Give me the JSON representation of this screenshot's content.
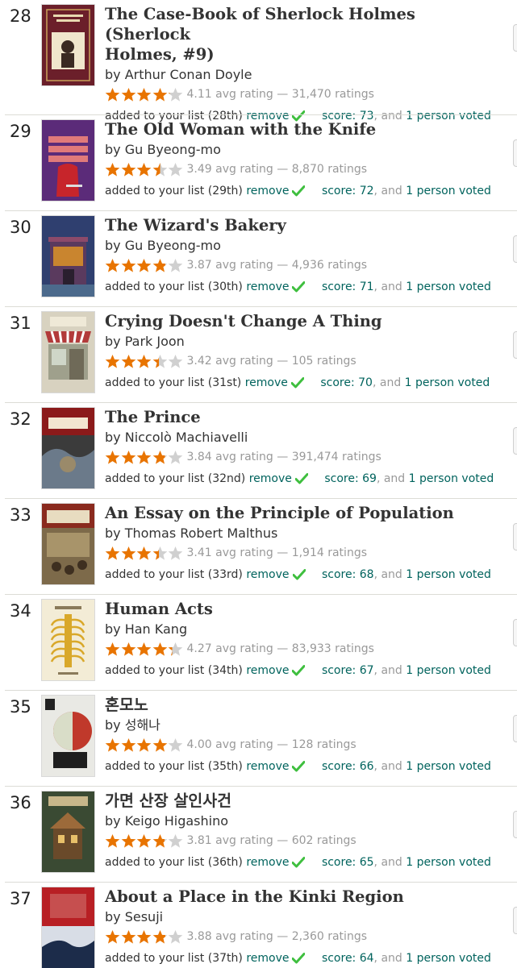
{
  "colors": {
    "link": "#00635d",
    "star": "#e87400",
    "star_empty": "#d0d0d0",
    "check": "#3fbf3f",
    "muted": "#999999",
    "text": "#333333"
  },
  "books": [
    {
      "rank": "28",
      "title_lines": [
        "The Case-Book of Sherlock Holmes (Sherlock",
        "Holmes, #9)"
      ],
      "by": "by",
      "author": "Arthur Conan Doyle",
      "rating": 4.11,
      "rating_text": "4.11 avg rating — 31,470 ratings",
      "added_prefix": "added to your list (28th)",
      "remove_label": "remove",
      "score_label": "score: 73",
      "score_sep": ", and",
      "voted_label": "1 person voted",
      "cover": {
        "bg": "#6b1f2a",
        "accent": "#f0e6cc",
        "icon": "sherlock-cover"
      }
    },
    {
      "rank": "29",
      "title_lines": [
        "The Old Woman with the Knife"
      ],
      "by": "by",
      "author": "Gu Byeong-mo",
      "rating": 3.49,
      "rating_text": "3.49 avg rating — 8,870 ratings",
      "added_prefix": "added to your list (29th)",
      "remove_label": "remove",
      "score_label": "score: 72",
      "score_sep": ", and",
      "voted_label": "1 person voted",
      "cover": {
        "bg": "#5b2b79",
        "accent": "#c7252b",
        "icon": "old-woman-cover"
      }
    },
    {
      "rank": "30",
      "title_lines": [
        "The Wizard's Bakery"
      ],
      "by": "by",
      "author": "Gu Byeong-mo",
      "rating": 3.87,
      "rating_text": "3.87 avg rating — 4,936 ratings",
      "added_prefix": "added to your list (30th)",
      "remove_label": "remove",
      "score_label": "score: 71",
      "score_sep": ", and",
      "voted_label": "1 person voted",
      "cover": {
        "bg": "#2f3f6f",
        "accent": "#c9852f",
        "icon": "bakery-cover"
      }
    },
    {
      "rank": "31",
      "title_lines": [
        "Crying Doesn't Change A Thing"
      ],
      "by": "by",
      "author": "Park Joon",
      "rating": 3.42,
      "rating_text": "3.42 avg rating — 105 ratings",
      "added_prefix": "added to your list (31st)",
      "remove_label": "remove",
      "score_label": "score: 70",
      "score_sep": ", and",
      "voted_label": "1 person voted",
      "cover": {
        "bg": "#d8d2c0",
        "accent": "#b23a3a",
        "icon": "storefront-cover"
      }
    },
    {
      "rank": "32",
      "title_lines": [
        "The Prince"
      ],
      "by": "by",
      "author": "Niccolò Machiavelli",
      "rating": 3.84,
      "rating_text": "3.84 avg rating — 391,474 ratings",
      "added_prefix": "added to your list (32nd)",
      "remove_label": "remove",
      "score_label": "score: 69",
      "score_sep": ", and",
      "voted_label": "1 person voted",
      "cover": {
        "bg": "#3b3b3b",
        "accent": "#8b1a1a",
        "icon": "prince-cover"
      }
    },
    {
      "rank": "33",
      "title_lines": [
        "An Essay on the Principle of Population"
      ],
      "by": "by",
      "author": "Thomas Robert Malthus",
      "rating": 3.41,
      "rating_text": "3.41 avg rating — 1,914 ratings",
      "added_prefix": "added to your list (33rd)",
      "remove_label": "remove",
      "score_label": "score: 68",
      "score_sep": ", and",
      "voted_label": "1 person voted",
      "cover": {
        "bg": "#8a2a1e",
        "accent": "#e8dcc0",
        "icon": "population-cover"
      }
    },
    {
      "rank": "34",
      "title_lines": [
        "Human Acts"
      ],
      "by": "by",
      "author": "Han Kang",
      "rating": 4.27,
      "rating_text": "4.27 avg rating — 83,933 ratings",
      "added_prefix": "added to your list (34th)",
      "remove_label": "remove",
      "score_label": "score: 67",
      "score_sep": ", and",
      "voted_label": "1 person voted",
      "cover": {
        "bg": "#f3ecd6",
        "accent": "#d9a82a",
        "icon": "human-acts-cover"
      }
    },
    {
      "rank": "35",
      "title_lines": [
        "혼모노"
      ],
      "by": "by",
      "author": "성해나",
      "rating": 4.0,
      "rating_text": "4.00 avg rating — 128 ratings",
      "added_prefix": "added to your list (35th)",
      "remove_label": "remove",
      "score_label": "score: 66",
      "score_sep": ", and",
      "voted_label": "1 person voted",
      "cover": {
        "bg": "#e9e9e4",
        "accent": "#c0392b",
        "icon": "apple-cover"
      }
    },
    {
      "rank": "36",
      "title_lines": [
        "가면 산장 살인사건"
      ],
      "by": "by",
      "author": "Keigo Higashino",
      "rating": 3.81,
      "rating_text": "3.81 avg rating — 602 ratings",
      "added_prefix": "added to your list (36th)",
      "remove_label": "remove",
      "score_label": "score: 65",
      "score_sep": ", and",
      "voted_label": "1 person voted",
      "cover": {
        "bg": "#3a4a33",
        "accent": "#9c6a3a",
        "icon": "villa-cover"
      }
    },
    {
      "rank": "37",
      "title_lines": [
        "About a Place in the Kinki Region"
      ],
      "by": "by",
      "author": "Sesuji",
      "rating": 3.88,
      "rating_text": "3.88 avg rating — 2,360 ratings",
      "added_prefix": "added to your list (37th)",
      "remove_label": "remove",
      "score_label": "score: 64",
      "score_sep": ", and",
      "voted_label": "1 person voted",
      "cover": {
        "bg": "#b81f24",
        "accent": "#1c2c4a",
        "icon": "kinki-cover"
      }
    }
  ]
}
